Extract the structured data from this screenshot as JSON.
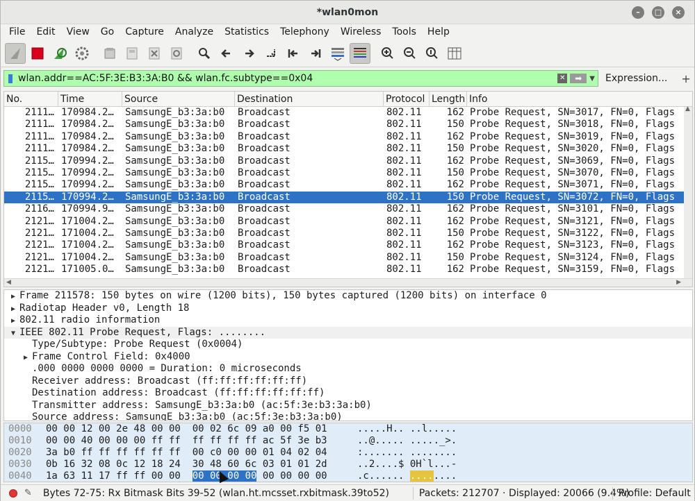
{
  "window": {
    "title": "*wlan0mon"
  },
  "menu": [
    "File",
    "Edit",
    "View",
    "Go",
    "Capture",
    "Analyze",
    "Statistics",
    "Telephony",
    "Wireless",
    "Tools",
    "Help"
  ],
  "toolbar_icons": [
    "shark-fin-icon",
    "stop-icon",
    "restart-icon",
    "options-gear-icon",
    "open-folder-icon",
    "save-icon",
    "close-file-icon",
    "reload-icon",
    "find-icon",
    "back-icon",
    "forward-icon",
    "goto-packet-icon",
    "first-packet-icon",
    "last-packet-icon",
    "autoscroll-icon",
    "colorize-icon",
    "zoom-in-icon",
    "zoom-out-icon",
    "zoom-normal-icon",
    "resize-columns-icon"
  ],
  "filter": {
    "value": "wlan.addr==AC:5F:3E:B3:3A:B0 && wlan.fc.subtype==0x04",
    "expression_label": "Expression...",
    "add_label": "+"
  },
  "packet_list": {
    "columns": [
      "No.",
      "Time",
      "Source",
      "Destination",
      "Protocol",
      "Length",
      "Info"
    ],
    "rows": [
      [
        "2111…",
        "170984.2…",
        "SamsungE_b3:3a:b0",
        "Broadcast",
        "802.11",
        "162",
        "Probe Request, SN=3017, FN=0, Flags"
      ],
      [
        "2111…",
        "170984.2…",
        "SamsungE_b3:3a:b0",
        "Broadcast",
        "802.11",
        "150",
        "Probe Request, SN=3018, FN=0, Flags"
      ],
      [
        "2111…",
        "170984.2…",
        "SamsungE_b3:3a:b0",
        "Broadcast",
        "802.11",
        "162",
        "Probe Request, SN=3019, FN=0, Flags"
      ],
      [
        "2111…",
        "170984.2…",
        "SamsungE_b3:3a:b0",
        "Broadcast",
        "802.11",
        "150",
        "Probe Request, SN=3020, FN=0, Flags"
      ],
      [
        "2115…",
        "170994.2…",
        "SamsungE_b3:3a:b0",
        "Broadcast",
        "802.11",
        "162",
        "Probe Request, SN=3069, FN=0, Flags"
      ],
      [
        "2115…",
        "170994.2…",
        "SamsungE_b3:3a:b0",
        "Broadcast",
        "802.11",
        "150",
        "Probe Request, SN=3070, FN=0, Flags"
      ],
      [
        "2115…",
        "170994.2…",
        "SamsungE_b3:3a:b0",
        "Broadcast",
        "802.11",
        "162",
        "Probe Request, SN=3071, FN=0, Flags"
      ],
      [
        "2115…",
        "170994.2…",
        "SamsungE_b3:3a:b0",
        "Broadcast",
        "802.11",
        "150",
        "Probe Request, SN=3072, FN=0, Flags"
      ],
      [
        "2116…",
        "170994.9…",
        "SamsungE_b3:3a:b0",
        "Broadcast",
        "802.11",
        "162",
        "Probe Request, SN=3101, FN=0, Flags"
      ],
      [
        "2121…",
        "171004.2…",
        "SamsungE_b3:3a:b0",
        "Broadcast",
        "802.11",
        "162",
        "Probe Request, SN=3121, FN=0, Flags"
      ],
      [
        "2121…",
        "171004.2…",
        "SamsungE_b3:3a:b0",
        "Broadcast",
        "802.11",
        "150",
        "Probe Request, SN=3122, FN=0, Flags"
      ],
      [
        "2121…",
        "171004.2…",
        "SamsungE_b3:3a:b0",
        "Broadcast",
        "802.11",
        "162",
        "Probe Request, SN=3123, FN=0, Flags"
      ],
      [
        "2121…",
        "171004.2…",
        "SamsungE_b3:3a:b0",
        "Broadcast",
        "802.11",
        "150",
        "Probe Request, SN=3124, FN=0, Flags"
      ],
      [
        "2121…",
        "171005.0…",
        "SamsungE_b3:3a:b0",
        "Broadcast",
        "802.11",
        "162",
        "Probe Request, SN=3159, FN=0, Flags"
      ]
    ],
    "selected_index": 7,
    "selected_color": "#2d72c4"
  },
  "details": [
    {
      "expander": "▶",
      "indent": 0,
      "text": "Frame 211578: 150 bytes on wire (1200 bits), 150 bytes captured (1200 bits) on interface 0"
    },
    {
      "expander": "▶",
      "indent": 0,
      "text": "Radiotap Header v0, Length 18"
    },
    {
      "expander": "▶",
      "indent": 0,
      "text": "802.11 radio information"
    },
    {
      "expander": "▼",
      "indent": 0,
      "text": "IEEE 802.11 Probe Request, Flags: ........"
    },
    {
      "expander": "",
      "indent": 1,
      "text": "Type/Subtype: Probe Request (0x0004)"
    },
    {
      "expander": "▶",
      "indent": 1,
      "text": "Frame Control Field: 0x4000"
    },
    {
      "expander": "",
      "indent": 1,
      "text": ".000 0000 0000 0000 = Duration: 0 microseconds"
    },
    {
      "expander": "",
      "indent": 1,
      "text": "Receiver address: Broadcast (ff:ff:ff:ff:ff:ff)"
    },
    {
      "expander": "",
      "indent": 1,
      "text": "Destination address: Broadcast (ff:ff:ff:ff:ff:ff)"
    },
    {
      "expander": "",
      "indent": 1,
      "text": "Transmitter address: SamsungE_b3:3a:b0 (ac:5f:3e:b3:3a:b0)"
    },
    {
      "expander": "",
      "indent": 1,
      "text": "Source address: SamsungE_b3:3a:b0 (ac:5f:3e:b3:3a:b0)"
    }
  ],
  "bytes": [
    {
      "offset": "0000",
      "hex": "00 00 12 00 2e 48 00 00  00 02 6c 09 a0 00 f5 01",
      "ascii": ".....H.. ..l....."
    },
    {
      "offset": "0010",
      "hex": "00 00 40 00 00 00 ff ff  ff ff ff ff ac 5f 3e b3",
      "ascii": "..@..... ....._>."
    },
    {
      "offset": "0020",
      "hex": "3a b0 ff ff ff ff ff ff  00 c0 00 00 01 04 02 04",
      "ascii": ":....... ........"
    },
    {
      "offset": "0030",
      "hex": "0b 16 32 08 0c 12 18 24  30 48 60 6c 03 01 01 2d",
      "ascii": "..2....$ 0H`l...-"
    },
    {
      "offset": "0040",
      "hex_pre": "1a 63 11 17 ff ff 00 00  ",
      "hex_hl": "00 00 00 00",
      "hex_post": " 00 00 00 00",
      "ascii_pre": ".c...... ",
      "ascii_hl": "....",
      "ascii_post": "...."
    }
  ],
  "status": {
    "field_info": "Bytes 72-75: Rx Bitmask Bits 39-52 (wlan.ht.mcsset.rxbitmask.39to52)",
    "packets": "Packets: 212707 · Displayed: 20066 (9.4%)",
    "profile": "Profile: Default"
  }
}
